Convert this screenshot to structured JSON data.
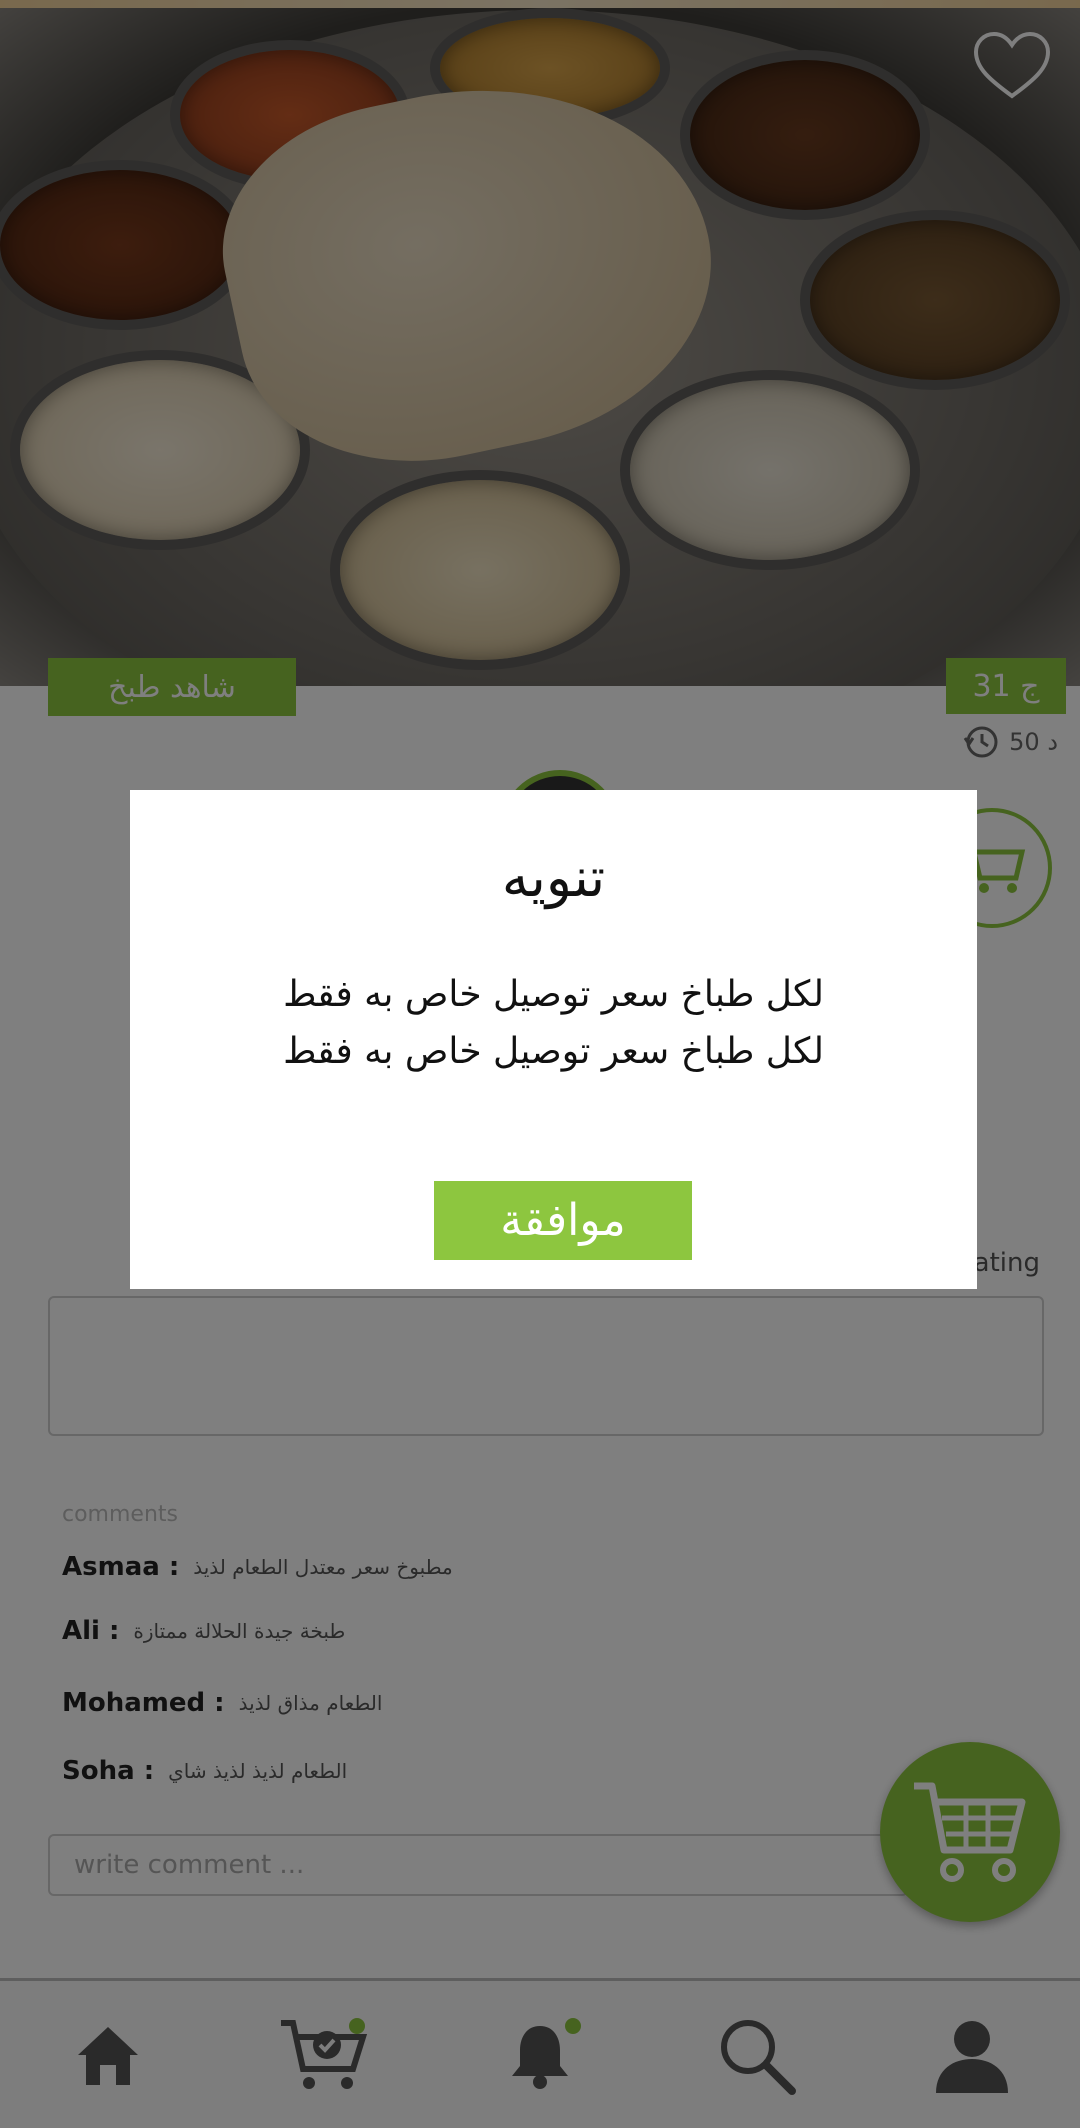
{
  "hero": {
    "image_name": "thali-food-photo",
    "favorite_icon": "heart-outline-icon"
  },
  "product": {
    "tag_left": "شاهد طبخ",
    "price_tag": "31 ج",
    "prep_time": "50 د",
    "time_icon": "history-clock-icon",
    "cart_icon": "cart-icon"
  },
  "rating": {
    "label": "rating"
  },
  "comments": {
    "title": "comments",
    "items": [
      {
        "name": "Asmaa :",
        "text": "مطبوخ سعر معتدل الطعام لذيذ"
      },
      {
        "name": "Ali :",
        "text": "طبخة جيدة الحلالة ممتازة"
      },
      {
        "name": "Mohamed :",
        "text": "الطعام مذاق لذيذ"
      },
      {
        "name": "Soha :",
        "text": "الطعام لذيذ لذيذ شاي"
      }
    ],
    "write_placeholder": "write comment ..."
  },
  "fab": {
    "icon": "shopping-cart-icon"
  },
  "bottom_nav": [
    {
      "icon": "home-icon",
      "badge": false
    },
    {
      "icon": "cart-check-icon",
      "badge": true
    },
    {
      "icon": "bell-icon",
      "badge": true
    },
    {
      "icon": "search-icon",
      "badge": false
    },
    {
      "icon": "user-icon",
      "badge": false
    }
  ],
  "dialog": {
    "title": "تنويه",
    "message_line1": "لكل طباخ سعر توصيل خاص به فقط",
    "message_line2": "لكل طباخ سعر توصيل خاص به فقط",
    "ok_label": "موافقة"
  },
  "colors": {
    "accent": "#8dc63f",
    "overlay": "rgba(0,0,0,0.5)"
  }
}
